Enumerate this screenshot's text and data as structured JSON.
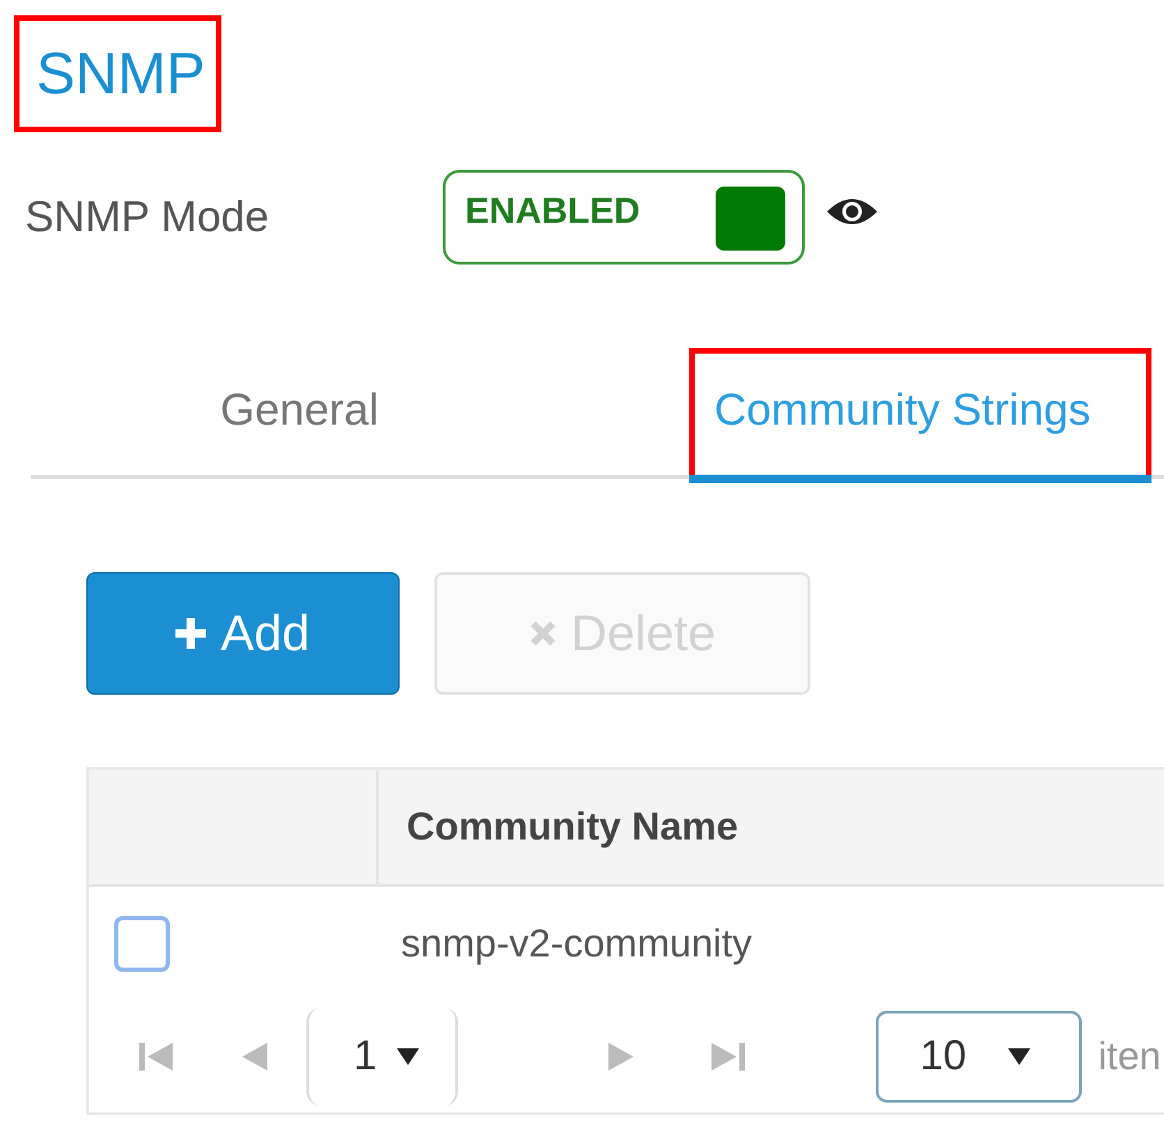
{
  "title": {
    "text": "SNMP",
    "highlighted": true
  },
  "mode": {
    "label": "SNMP Mode",
    "toggle_text": "ENABLED",
    "on": true
  },
  "tabs": [
    {
      "label": "General",
      "selected": false,
      "highlighted": false
    },
    {
      "label": "Community Strings",
      "selected": true,
      "highlighted": true
    }
  ],
  "buttons": [
    {
      "kind": "add",
      "label": "Add",
      "disabled": false
    },
    {
      "kind": "delete",
      "label": "Delete",
      "disabled": true
    }
  ],
  "table": {
    "columns": [
      "Community Name"
    ],
    "rows": [
      {
        "checked": false,
        "community_name": "snmp-v2-community"
      }
    ]
  },
  "pagination": {
    "page": "1",
    "page_size": "10",
    "page_size_label": "iten"
  }
}
